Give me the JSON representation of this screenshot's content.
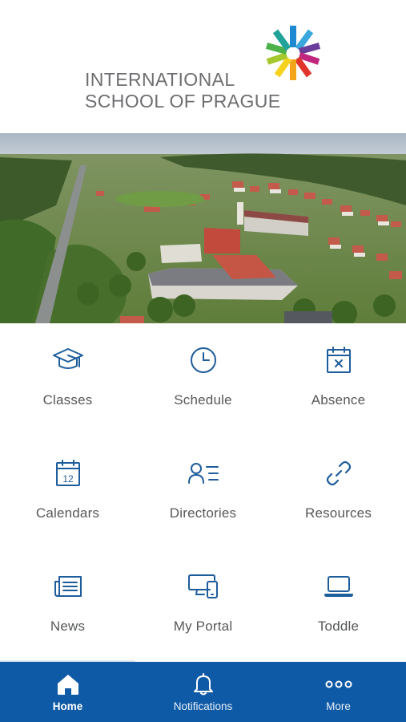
{
  "header": {
    "logo_line1": "INTERNATIONAL",
    "logo_line2": "SCHOOL OF PRAGUE"
  },
  "hero": {
    "image": "aerial-campus-photo"
  },
  "menu": [
    {
      "label": "Classes",
      "icon": "graduation-cap-icon"
    },
    {
      "label": "Schedule",
      "icon": "clock-icon"
    },
    {
      "label": "Absence",
      "icon": "calendar-x-icon"
    },
    {
      "label": "Calendars",
      "icon": "calendar-12-icon"
    },
    {
      "label": "Directories",
      "icon": "person-list-icon"
    },
    {
      "label": "Resources",
      "icon": "link-icon"
    },
    {
      "label": "News",
      "icon": "newspaper-icon"
    },
    {
      "label": "My Portal",
      "icon": "devices-icon"
    },
    {
      "label": "Toddle",
      "icon": "laptop-icon"
    }
  ],
  "bottom_nav": {
    "items": [
      {
        "label": "Home",
        "icon": "home-icon",
        "active": true
      },
      {
        "label": "Notifications",
        "icon": "bell-icon"
      },
      {
        "label": "More",
        "icon": "more-dots-icon"
      }
    ]
  },
  "colors": {
    "accent": "#1e5d9b",
    "nav_background": "#0f5aa6",
    "label_text": "#555759",
    "logo_text": "#6d6e71"
  }
}
